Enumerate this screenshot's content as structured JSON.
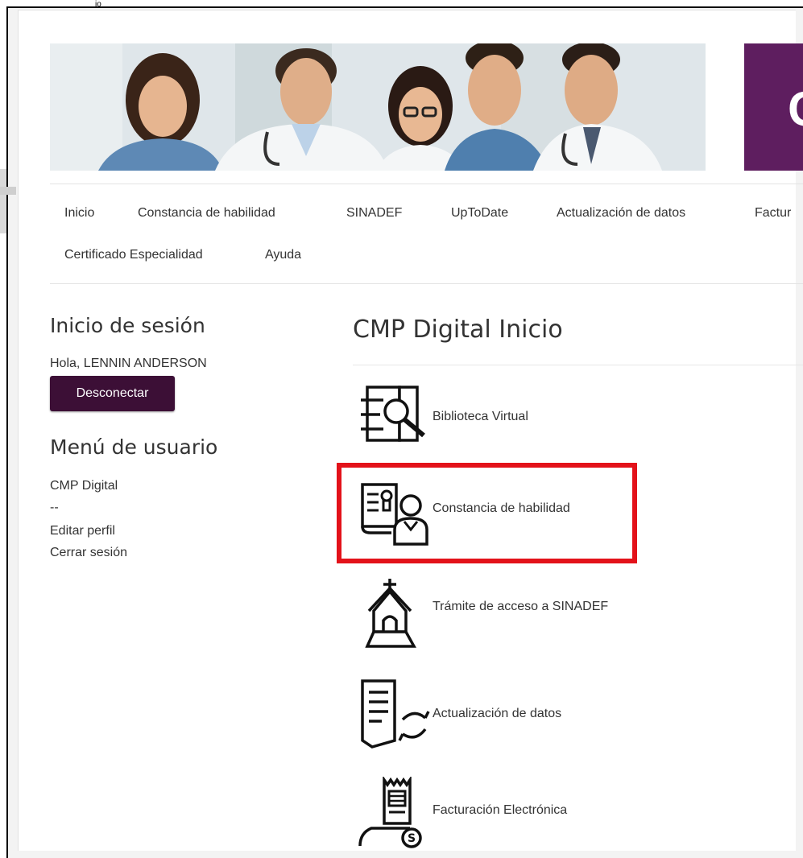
{
  "top_fragment": "jo",
  "banner": {
    "right_letter": "C"
  },
  "nav": {
    "items": [
      "Inicio",
      "Constancia de habilidad",
      "SINADEF",
      "UpToDate",
      "Actualización de datos",
      "Factur",
      "Certificado Especialidad",
      "Ayuda"
    ]
  },
  "login": {
    "title": "Inicio de sesión",
    "greeting": "Hola, LENNIN ANDERSON",
    "logout_label": "Desconectar"
  },
  "user_menu": {
    "title": "Menú de usuario",
    "items": [
      "CMP Digital",
      "--",
      "Editar perfil",
      "Cerrar sesión"
    ]
  },
  "main": {
    "title": "CMP Digital Inicio",
    "tiles": [
      {
        "label": "Biblioteca Virtual",
        "icon": "book-search-icon"
      },
      {
        "label": "Constancia de habilidad",
        "icon": "certificate-person-icon"
      },
      {
        "label": "Trámite de acceso a SINADEF",
        "icon": "chapel-icon"
      },
      {
        "label": "Actualización de datos",
        "icon": "document-refresh-icon"
      },
      {
        "label": "Facturación Electrónica",
        "icon": "receipt-coin-icon"
      }
    ]
  },
  "colors": {
    "brand_purple": "#5e1e5f",
    "button_dark": "#3c0f36",
    "highlight_red": "#e3121a"
  }
}
